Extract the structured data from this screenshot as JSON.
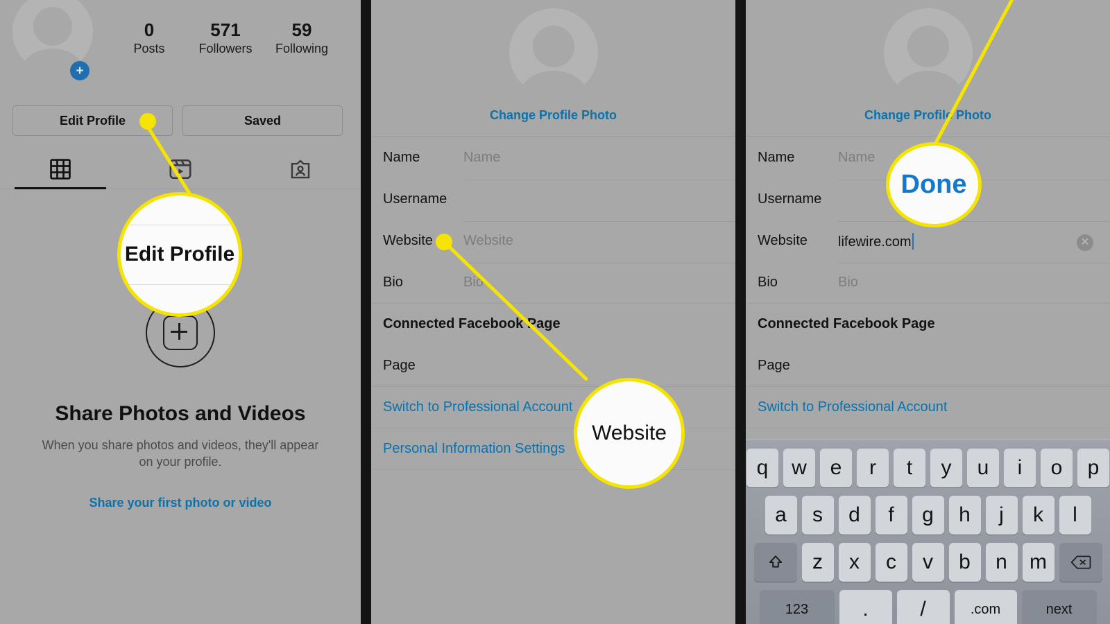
{
  "background_color": "#a8a8a8",
  "accent_link_color": "#0b72ac",
  "highlight_color": "#f5e400",
  "panels": [
    {
      "id": "profile",
      "avatar": {
        "icon": "person-avatar-icon",
        "add_badge_icon": "plus-icon"
      },
      "stats": [
        {
          "number": "0",
          "label": "Posts"
        },
        {
          "number": "571",
          "label": "Followers"
        },
        {
          "number": "59",
          "label": "Following"
        }
      ],
      "buttons": [
        {
          "label": "Edit Profile",
          "name": "edit-profile-button"
        },
        {
          "label": "Saved",
          "name": "saved-button"
        }
      ],
      "tabs": [
        {
          "icon": "grid-icon",
          "name": "tab-grid",
          "active": true
        },
        {
          "icon": "reels-icon",
          "name": "tab-reels",
          "active": false
        },
        {
          "icon": "tagged-icon",
          "name": "tab-tagged",
          "active": false
        }
      ],
      "empty_state": {
        "icon": "add-photo-icon",
        "title": "Share Photos and Videos",
        "subtitle": "When you share photos and videos, they'll appear on your profile.",
        "link": "Share your first photo or video"
      }
    },
    {
      "id": "edit-profile-empty",
      "change_photo_label": "Change Profile Photo",
      "fields": [
        {
          "label": "Name",
          "value": "",
          "placeholder": "Name"
        },
        {
          "label": "Username",
          "value": "",
          "placeholder": ""
        },
        {
          "label": "Website",
          "value": "",
          "placeholder": "Website"
        },
        {
          "label": "Bio",
          "value": "",
          "placeholder": "Bio"
        }
      ],
      "section_title": "Connected Facebook Page",
      "section_item": "Page",
      "links": [
        "Switch to Professional Account",
        "Personal Information Settings"
      ]
    },
    {
      "id": "edit-profile-typing",
      "change_photo_label": "Change Profile Photo",
      "fields": [
        {
          "label": "Name",
          "value": "",
          "placeholder": "Name"
        },
        {
          "label": "Username",
          "value": "",
          "placeholder": ""
        },
        {
          "label": "Website",
          "value": "lifewire.com",
          "placeholder": "Website",
          "has_clear": true,
          "clear_icon": "clear-x-icon",
          "focused": true
        },
        {
          "label": "Bio",
          "value": "",
          "placeholder": "Bio"
        }
      ],
      "section_title": "Connected Facebook Page",
      "section_item": "Page",
      "links": [
        "Switch to Professional Account"
      ],
      "keyboard": {
        "row1": [
          "q",
          "w",
          "e",
          "r",
          "t",
          "y",
          "u",
          "i",
          "o",
          "p"
        ],
        "row2": [
          "a",
          "s",
          "d",
          "f",
          "g",
          "h",
          "j",
          "k",
          "l"
        ],
        "row3": [
          "z",
          "x",
          "c",
          "v",
          "b",
          "n",
          "m"
        ],
        "shift_icon": "shift-arrow-icon",
        "backspace_icon": "backspace-icon",
        "row4": [
          "123",
          ".",
          "/",
          ".com",
          "next"
        ]
      }
    }
  ],
  "callouts": [
    {
      "name": "callout-edit-profile",
      "text": "Edit Profile",
      "style": "bold"
    },
    {
      "name": "callout-website",
      "text": "Website",
      "style": "plain"
    },
    {
      "name": "callout-done",
      "text": "Done",
      "style": "blue"
    }
  ]
}
